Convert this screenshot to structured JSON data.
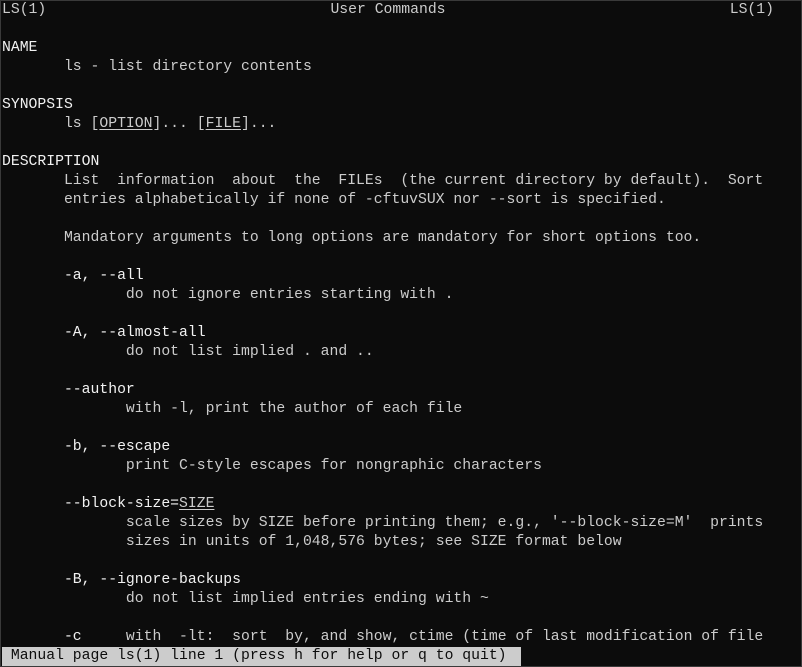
{
  "header": {
    "left": "LS(1)",
    "center": "User Commands",
    "right": "LS(1)"
  },
  "lines": [
    [],
    [
      {
        "t": "NAME",
        "b": true
      }
    ],
    [
      {
        "t": "       ls - list directory contents"
      }
    ],
    [],
    [
      {
        "t": "SYNOPSIS",
        "b": true
      }
    ],
    [
      {
        "t": "       ls ["
      },
      {
        "t": "OPTION",
        "u": true
      },
      {
        "t": "]... ["
      },
      {
        "t": "FILE",
        "u": true
      },
      {
        "t": "]..."
      }
    ],
    [],
    [
      {
        "t": "DESCRIPTION",
        "b": true
      }
    ],
    [
      {
        "t": "       List  information  about  the  FILEs  (the current directory by default).  Sort"
      }
    ],
    [
      {
        "t": "       entries alphabetically if none of -cftuvSUX nor --sort is specified."
      }
    ],
    [],
    [
      {
        "t": "       Mandatory arguments to long options are mandatory for short options too."
      }
    ],
    [],
    [
      {
        "t": "       -a, --all",
        "b": true
      }
    ],
    [
      {
        "t": "              do not ignore entries starting with ."
      }
    ],
    [],
    [
      {
        "t": "       -A, --almost-all",
        "b": true
      }
    ],
    [
      {
        "t": "              do not list implied . and .."
      }
    ],
    [],
    [
      {
        "t": "       --author",
        "b": true
      }
    ],
    [
      {
        "t": "              with -l, print the author of each file"
      }
    ],
    [],
    [
      {
        "t": "       -b, --escape",
        "b": true
      }
    ],
    [
      {
        "t": "              print C-style escapes for nongraphic characters"
      }
    ],
    [],
    [
      {
        "t": "       --block-size=",
        "b": true
      },
      {
        "t": "SIZE",
        "u": true
      }
    ],
    [
      {
        "t": "              scale sizes by SIZE before printing them; e.g., '--block-size=M'  prints"
      }
    ],
    [
      {
        "t": "              sizes in units of 1,048,576 bytes; see SIZE format below"
      }
    ],
    [],
    [
      {
        "t": "       -B, --ignore-backups",
        "b": true
      }
    ],
    [
      {
        "t": "              do not list implied entries ending with ~"
      }
    ],
    [],
    [
      {
        "t": "       -c",
        "b": true
      },
      {
        "t": "     with  -lt:  sort  by, and show, ctime (time of last modification of file"
      }
    ]
  ],
  "status": " Manual page ls(1) line 1 (press h for help or q to quit)"
}
